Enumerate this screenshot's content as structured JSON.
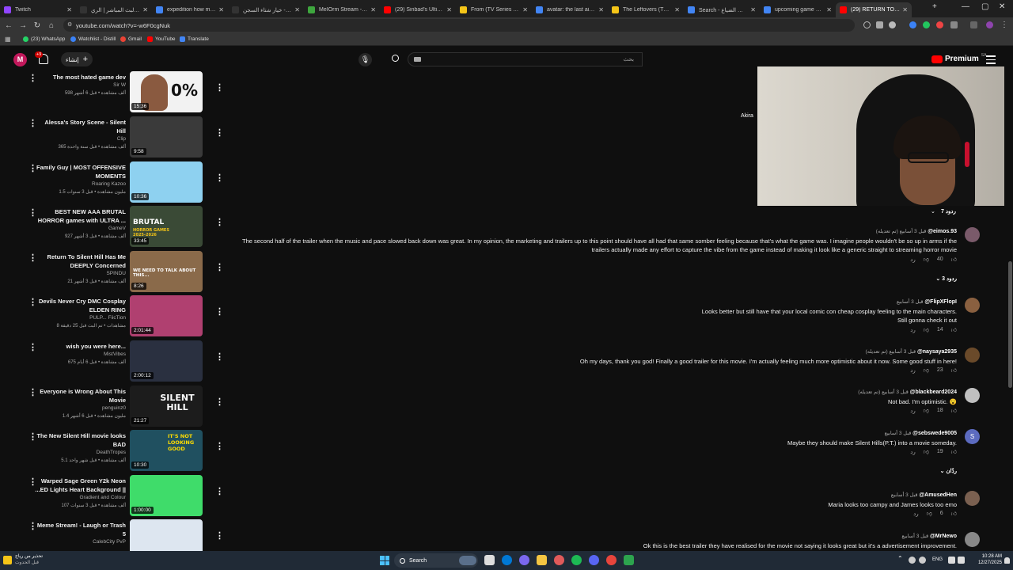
{
  "tabs": [
    {
      "label": "Twitch",
      "color": "#9146ff",
      "active": false
    },
    {
      "label": "سجل البث المباشر | الري...",
      "color": "#333333",
      "active": false
    },
    {
      "label": "expedition how many...",
      "color": "#4285f4",
      "active": false
    },
    {
      "label": "كرتيز - خيار شتاء السجن...",
      "color": "#333333",
      "active": false
    },
    {
      "label": "MeIOrm Stream - Wat...",
      "color": "#3ea63e",
      "active": false
    },
    {
      "label": "(29) Sinbad's Ultimat...",
      "color": "#ff0000",
      "active": false
    },
    {
      "label": "From (TV Series 2022-...",
      "color": "#f5c518",
      "active": false
    },
    {
      "label": "avatar: the last airben...",
      "color": "#4285f4",
      "active": false
    },
    {
      "label": "The Leftovers (TV Serie...",
      "color": "#f5c518",
      "active": false
    },
    {
      "label": "Search - سنوات الضياع",
      "color": "#4285f4",
      "active": false
    },
    {
      "label": "upcoming game adap...",
      "color": "#4285f4",
      "active": false
    },
    {
      "label": "(29) RETURN TO SILEN...",
      "color": "#ff0000",
      "active": true
    }
  ],
  "address": {
    "url": "youtube.com/watch?v=-w6F0cgNuk"
  },
  "bookmarks": [
    {
      "label": "(23) WhatsApp",
      "color": "#25d366"
    },
    {
      "label": "Watchlist - Distill",
      "color": "#3b82f6"
    },
    {
      "label": "Gmail",
      "color": "#ea4335"
    },
    {
      "label": "YouTube",
      "color": "#ff0000"
    },
    {
      "label": "Translate",
      "color": "#4285f4"
    }
  ],
  "yt": {
    "avatar_letter": "M",
    "notif_count": "+9",
    "create_label": "إنشاء",
    "search_placeholder": "بحث",
    "premium_label": "Premium",
    "premium_region": "SA",
    "streamer_name": "Akira"
  },
  "videos": [
    {
      "title": "The most hated game dev",
      "channel": "Sir W",
      "meta": "598 ألف مشاهدة • قبل 6 أشهر",
      "duration": "15:36",
      "thumb_text": "0%",
      "thumb_bg": "#f2f2f2",
      "thumb_fg": "#111111"
    },
    {
      "title": "Alessa's Story Scene - Silent Hill",
      "channel": "Clip",
      "meta": "365 ألف مشاهدة • قبل سنة واحدة",
      "duration": "9:58",
      "thumb_text": "",
      "thumb_bg": "#3a3a3a",
      "thumb_fg": "#ffffff"
    },
    {
      "title": "Family Guy | MOST OFFENSIVE MOMENTS",
      "channel": "Roaring Kazoo",
      "meta": "1.5 مليون مشاهدة • قبل 3 سنوات",
      "duration": "10:36",
      "thumb_text": "",
      "thumb_bg": "#8ed1f0",
      "thumb_fg": "#ffffff"
    },
    {
      "title": "BEST NEW AAA BRUTAL HORROR games with ULTRA ...",
      "channel": "GameV",
      "meta": "927 ألف مشاهدة • قبل 3 أشهر",
      "duration": "33:45",
      "thumb_text": "BRUTAL",
      "thumb_sub": "HORROR GAMES 2025-2026",
      "thumb_bg": "#3a4a36",
      "thumb_fg": "#ffffff"
    },
    {
      "title": "Return To Silent Hill Has Me DEEPLY Concerned",
      "channel": "SPINDU",
      "meta": "21 ألف مشاهدة • قبل 3 أشهر",
      "duration": "8:26",
      "thumb_text": "WE NEED TO TALK ABOUT THIS...",
      "thumb_bg": "#8a6a4a",
      "thumb_fg": "#ffffff"
    },
    {
      "title": "Devils Never Cry DMC Cosplay ELDEN RING",
      "channel": "PULP... FiicTion",
      "meta": "8 مشاهدات • تم البث قبل 25 دقيقة",
      "duration": "2:01:44",
      "thumb_text": "",
      "thumb_bg": "#b04070",
      "thumb_fg": "#ffffff"
    },
    {
      "title": "wish you were here...",
      "channel": "MistVibes",
      "meta": "675 ألف مشاهدة • قبل 6 أيام",
      "duration": "2:00:12",
      "thumb_text": "",
      "thumb_bg": "#2a3040",
      "thumb_fg": "#ffffff"
    },
    {
      "title": "Everyone is Wrong About This Movie",
      "channel": "penguinz0",
      "meta": "1.4 مليون مشاهدة • قبل 6 أشهر",
      "duration": "21:27",
      "thumb_text": "SILENT HILL",
      "thumb_bg": "#1c1c1c",
      "thumb_fg": "#ffffff"
    },
    {
      "title": "The New Silent Hill movie looks BAD",
      "channel": "DeathTropes",
      "meta": "5.1 ألف مشاهدة • قبل شهر واحد",
      "duration": "10:30",
      "thumb_text": "IT'S NOT LOOKING GOOD",
      "thumb_bg": "#205060",
      "thumb_fg": "#ffdd00"
    },
    {
      "title": "Warped Sage Green Y2k Neon ...ED Lights Heart Background ||",
      "channel": "Gradient and Colour",
      "meta": "107 ألف مشاهدة • قبل 3 سنوات",
      "duration": "1:00:00",
      "thumb_text": "",
      "thumb_bg": "#3fdc6a",
      "thumb_fg": "#ffffff"
    },
    {
      "title": "Meme Stream! - Laugh or Trash 5",
      "channel": "CalebCity PvP",
      "meta": "",
      "duration": "",
      "thumb_text": "",
      "thumb_bg": "#dde6f0",
      "thumb_fg": "#ffffff"
    }
  ],
  "comments": [
    {
      "user": "@eimos.93",
      "time": "قبل 3 أسابيع (تم تعديله)",
      "text1": "The second half of the trailer when the music and pace slowed back down was great. In my opinion, the marketing and trailers up to this point should have all had that same somber feeling because that's what the game was. I imagine people wouldn't be so up in arms if the",
      "text2": "trailers actually made any effort to capture the vibe from the game instead of making it look like a generic straight to streaming horror movie",
      "likes": "40",
      "reply": "رد",
      "replies": "3 ردود",
      "avatar_color": "#7a5a6a"
    },
    {
      "user": "@FlipXFlopI",
      "time": "قبل 3 أسابيع",
      "text1": "Looks better but still have that your local comic con cheap cosplay feeling to the main characters.",
      "text2": "Still gonna check it out",
      "likes": "14",
      "reply": "رد",
      "avatar_color": "#8a6040"
    },
    {
      "user": "@naysaya2935",
      "time": "قبل 3 أسابيع (تم تعديله)",
      "text1": "Oh my days, thank you god! Finally a good trailer for this movie. I'm actually feeling much more optimistic about it now. Some good stuff in here!",
      "likes": "23",
      "reply": "رد",
      "avatar_color": "#6a4a2a"
    },
    {
      "user": "@blackbeard2024",
      "time": "قبل 3 أسابيع (تم تعديله)",
      "text1": "Not bad. I'm optimistic. 😮",
      "likes": "18",
      "reply": "رد",
      "avatar_color": "#c0c0c0"
    },
    {
      "user": "@sebswede9005",
      "time": "قبل 3 أسابيع",
      "text1": "Maybe they should make Silent Hills(P.T.) into a movie someday.",
      "likes": "19",
      "reply": "رد",
      "replies": "ردّان",
      "avatar_color": "#5c6bc0",
      "avatar_letter": "S"
    },
    {
      "user": "@AmusedHen",
      "time": "قبل 3 أسابيع",
      "text1": "Maria looks too  campy and James looks too emo",
      "likes": "6",
      "reply": "رد",
      "avatar_color": "#7a6050"
    },
    {
      "user": "@MrNewo",
      "time": "قبل 3 أسابيع",
      "text1": "Ok this is the best trailer they have realised for the movie not saying it looks great but it's a advertisement improvement.",
      "avatar_color": "#888888"
    }
  ],
  "top_replies": "7 ردود",
  "taskbar": {
    "weather": "تحذير من رياح",
    "weather2": "قبل الحدوث",
    "search": "Search",
    "lang": "ENG",
    "time": "10:28 AM",
    "date": "12/27/2025"
  }
}
